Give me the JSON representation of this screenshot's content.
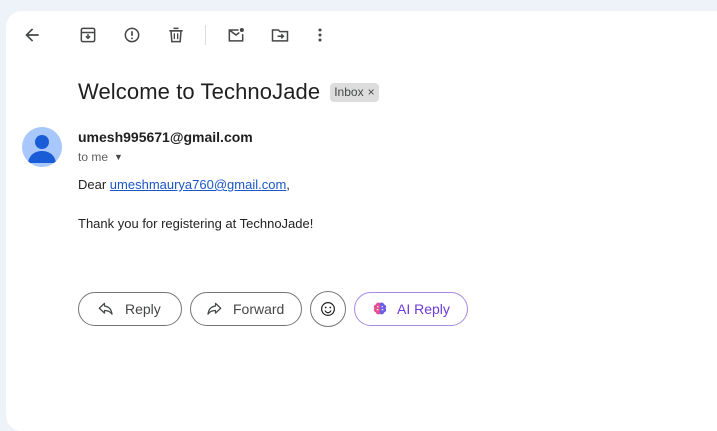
{
  "toolbar": {
    "back_icon": "arrow-left-icon",
    "archive_icon": "archive-icon",
    "spam_icon": "report-spam-icon",
    "delete_icon": "trash-icon",
    "mark_unread_icon": "mark-unread-icon",
    "move_icon": "move-to-folder-icon",
    "more_icon": "more-vert-icon"
  },
  "email": {
    "subject": "Welcome to TechnoJade",
    "label": "Inbox",
    "label_close": "×",
    "sender": "umesh995671@gmail.com",
    "recipient": "to me",
    "greeting_prefix": "Dear ",
    "greeting_email": "umeshmaurya760@gmail.com",
    "greeting_suffix": ",",
    "body_line": "Thank you for registering at TechnoJade!"
  },
  "actions": {
    "reply": "Reply",
    "forward": "Forward",
    "ai_reply": "AI Reply"
  },
  "colors": {
    "avatar_bg": "#a8c7fa",
    "avatar_fg": "#1a5cd6",
    "link": "#1a56c8",
    "ai_accent": "#6d3bd9"
  }
}
